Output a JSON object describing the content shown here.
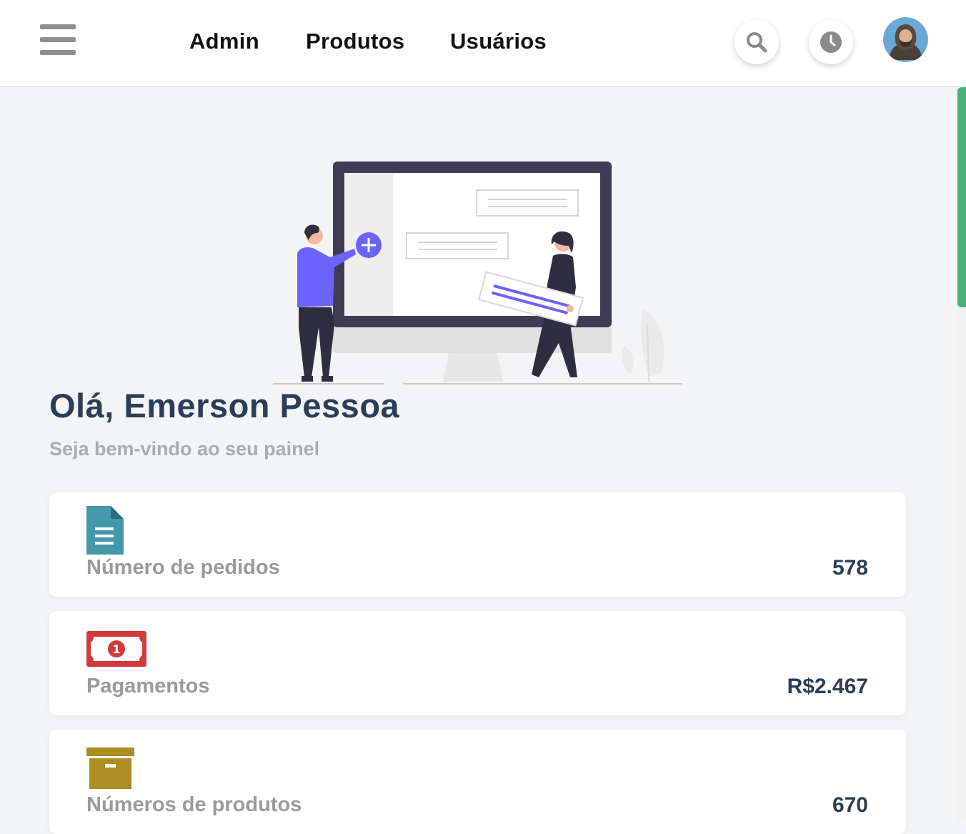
{
  "header": {
    "menu_icon": "hamburger-menu-icon",
    "nav": [
      {
        "label": "Admin"
      },
      {
        "label": "Produtos"
      },
      {
        "label": "Usuários"
      }
    ],
    "actions": [
      {
        "icon": "search-icon"
      },
      {
        "icon": "clock-icon"
      }
    ],
    "avatar_icon": "user-avatar"
  },
  "hero": {
    "illustration_icon": "dashboard-illustration",
    "greeting": "Olá, Emerson Pessoa",
    "subtitle": "Seja bem-vindo ao seu painel"
  },
  "stats": [
    {
      "icon": "document-icon",
      "label": "Número de pedidos",
      "value": "578",
      "color": "#4399a8"
    },
    {
      "icon": "money-bill-icon",
      "label": "Pagamentos",
      "value": "R$2.467",
      "color": "#d13b3b"
    },
    {
      "icon": "archive-box-icon",
      "label": "Números de produtos",
      "value": "670",
      "color": "#ad8c22"
    }
  ],
  "colors": {
    "accent": "#6c63ff",
    "heading": "#2c3e56",
    "muted": "#a9acb3",
    "scrollbar": "#4caf7a",
    "background": "#f3f4f6"
  }
}
